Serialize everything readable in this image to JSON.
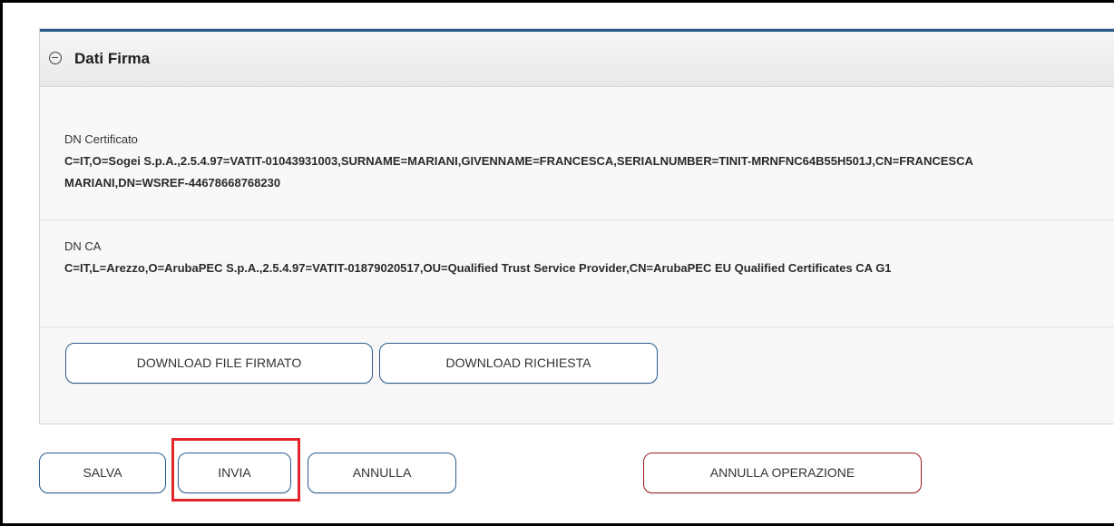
{
  "section": {
    "title": "Dati Firma",
    "toggle_icon": "collapse-minus-circle-icon"
  },
  "fields": {
    "dn_certificato": {
      "label": "DN Certificato",
      "value": "C=IT,O=Sogei S.p.A.,2.5.4.97=VATIT-01043931003,SURNAME=MARIANI,GIVENNAME=FRANCESCA,SERIALNUMBER=TINIT-MRNFNC64B55H501J,CN=FRANCESCA MARIANI,DN=WSREF-44678668768230"
    },
    "dn_ca": {
      "label": "DN CA",
      "value": "C=IT,L=Arezzo,O=ArubaPEC S.p.A.,2.5.4.97=VATIT-01879020517,OU=Qualified Trust Service Provider,CN=ArubaPEC EU Qualified Certificates CA G1"
    }
  },
  "panel_buttons": {
    "download_signed": "DOWNLOAD FILE FIRMATO",
    "download_request": "DOWNLOAD RICHIESTA"
  },
  "actions": {
    "salva": "SALVA",
    "invia": "INVIA",
    "annulla": "ANNULLA",
    "annulla_operazione": "ANNULLA OPERAZIONE"
  },
  "colors": {
    "accent": "#2c5d8f",
    "danger": "#9a1c1c",
    "highlight": "#e4262b"
  }
}
